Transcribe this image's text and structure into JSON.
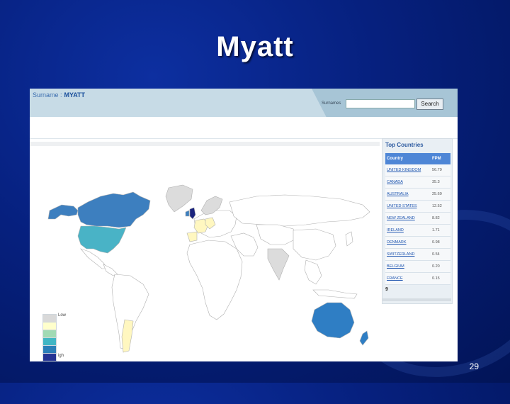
{
  "slide": {
    "title": "Myatt",
    "page_number": "29"
  },
  "header": {
    "surname_label": "Surname :",
    "surname_value": "MYATT",
    "search_label": "Surnames",
    "search_value": "",
    "search_button": "Search"
  },
  "legend": {
    "low": "Low",
    "high": "igh",
    "colors": [
      "#d9d9d9",
      "#ffffcc",
      "#a1dab4",
      "#41b6c4",
      "#2c7fb8",
      "#253494"
    ]
  },
  "map": {
    "colors": {
      "land": "#ffffff",
      "border": "#b0b0b0",
      "gray": "#dcdcdc",
      "uk": "#1a237e",
      "canada": "#3d7fbf",
      "usa": "#49b3c6",
      "australia": "#2f7ec4",
      "new_zealand": "#2f7ec4",
      "ireland": "#3d7fbf",
      "yellow": "#fff7c0"
    }
  },
  "top_countries": {
    "title": "Top Countries",
    "headers": [
      "Country",
      "FPM"
    ],
    "rows": [
      {
        "country": "UNITED KINGDOM",
        "fpm": "56.79"
      },
      {
        "country": "CANADA",
        "fpm": "35.3"
      },
      {
        "country": "AUSTRALIA",
        "fpm": "25.69"
      },
      {
        "country": "UNITED STATES",
        "fpm": "12.52"
      },
      {
        "country": "NEW ZEALAND",
        "fpm": "8.82"
      },
      {
        "country": "IRELAND",
        "fpm": "1.71"
      },
      {
        "country": "DENMARK",
        "fpm": "0.98"
      },
      {
        "country": "SWITZERLAND",
        "fpm": "0.54"
      },
      {
        "country": "BELGIUM",
        "fpm": "0.20"
      },
      {
        "country": "FRANCE",
        "fpm": "0.15"
      }
    ],
    "more": "9"
  }
}
